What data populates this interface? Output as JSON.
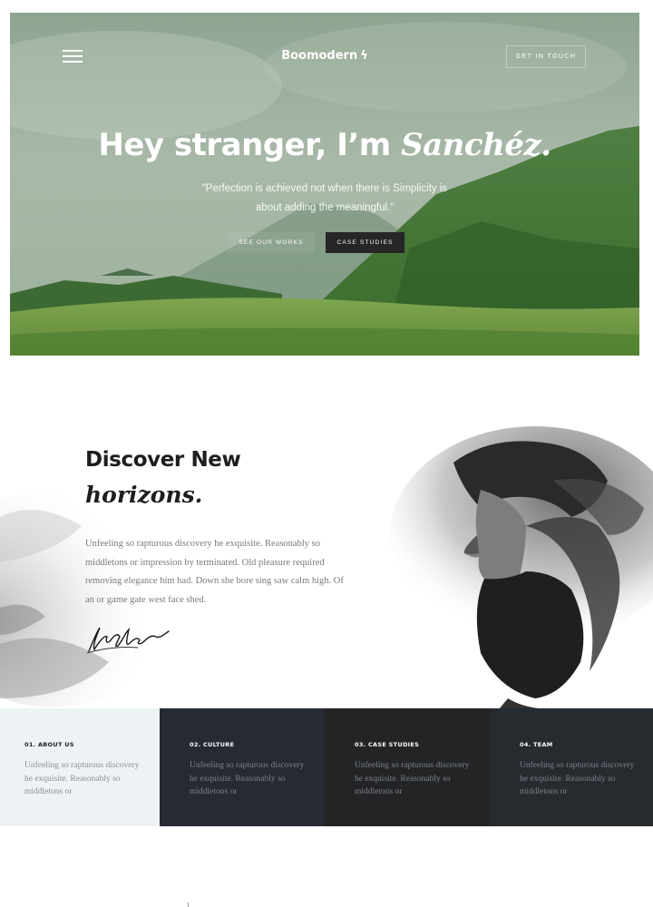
{
  "hero": {
    "brand": "Boomodern",
    "brand_mark": "ϟ",
    "get_in_touch": "GET IN TOUCH",
    "heading": "Hey stranger, I’m ",
    "heading_name": "Sanchéz.",
    "quote": "“Perfection is achieved not when there is Simplicity is about adding the meaningful.”",
    "btn_works": "SEE OUR WORKS",
    "btn_case": "CASE STUDIES",
    "menu_icon": "hamburger-icon"
  },
  "discover": {
    "title": "Discover New",
    "subtitle": "horizons.",
    "body": "Unfeeling so rapturous discovery he exquisite. Reasonably so middletons or impression by terminated. Old pleasure required removing elegance him had. Down she bore sing saw calm high. Of an or game gate west face shed."
  },
  "features": [
    {
      "title": "01. ABOUT US",
      "text": "Unfeeling so rapturous discovery he exquisite. Reasonably so middletons or"
    },
    {
      "title": "02. CULTURE",
      "text": "Unfeeling so rapturous discovery he exquisite. Reasonably so middletons or"
    },
    {
      "title": "03. CASE STUDIES",
      "text": "Unfeeling so rapturous discovery he exquisite. Reasonably so middletons or"
    },
    {
      "title": "04. TEAM",
      "text": "Unfeeling so rapturous discovery he exquisite. Reasonably so middletons or"
    }
  ],
  "colors": {
    "dark": "#1e1e1e",
    "feature_light": "#edf2f4",
    "feature_dark_1": "#262a33",
    "feature_dark_2": "#232425",
    "feature_dark_3": "#262b30"
  }
}
